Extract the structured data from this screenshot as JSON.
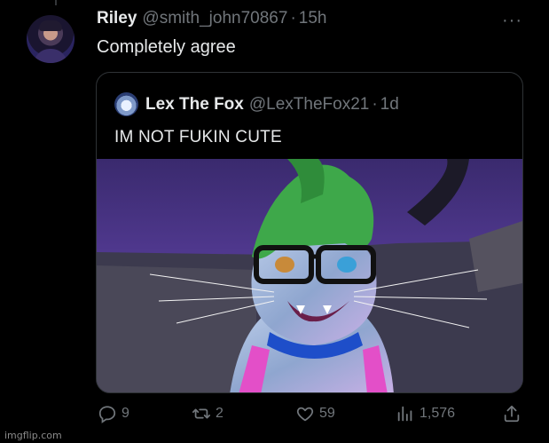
{
  "tweet": {
    "author_name": "Riley",
    "author_handle": "@smith_john70867",
    "separator": "·",
    "time": "15h",
    "more_icon": "more-horizontal-icon",
    "text": "Completely agree"
  },
  "quoted_tweet": {
    "author_name": "Lex The Fox",
    "author_handle": "@LexTheFox21",
    "separator": "·",
    "time": "1d",
    "text": "IM NOT FUKIN CUTE"
  },
  "actions": {
    "reply_count": "9",
    "retweet_count": "2",
    "like_count": "59",
    "view_count": "1,576"
  },
  "icons": {
    "reply": "reply-icon",
    "retweet": "retweet-icon",
    "like": "heart-icon",
    "views": "views-chart-icon",
    "share": "share-icon"
  },
  "watermark": "imgflip.com",
  "colors": {
    "background": "#000000",
    "text_primary": "#e7e9ea",
    "text_secondary": "#71767b",
    "border": "#2f3336"
  }
}
